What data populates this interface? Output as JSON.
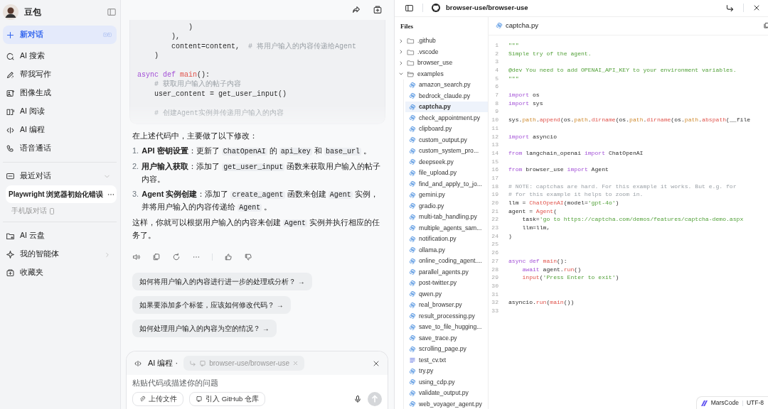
{
  "sidebar": {
    "brand": "豆包",
    "new_chat": {
      "label": "新对话",
      "selected": true
    },
    "nav_items": [
      {
        "label": "AI 搜索"
      },
      {
        "label": "帮我写作"
      },
      {
        "label": "图像生成"
      },
      {
        "label": "AI 阅读"
      },
      {
        "label": "AI 编程"
      },
      {
        "label": "语音通话"
      }
    ],
    "recent": {
      "title": "最近对话",
      "expanded": true,
      "chats": [
        {
          "title": "Playwright 浏览器初始化错误",
          "selected": true
        }
      ],
      "mobile_link": "手机版对话"
    },
    "bottom_items": [
      {
        "label": "AI 云盘",
        "has_submenu": false
      },
      {
        "label": "我的智能体",
        "has_submenu": true
      },
      {
        "label": "收藏夹",
        "has_submenu": false
      }
    ]
  },
  "chat": {
    "code_lines": [
      {
        "space_before": false,
        "tokens": [
          {
            "text": "            )",
            "kind": "plain"
          }
        ]
      },
      {
        "space_before": false,
        "tokens": [
          {
            "text": "        ),",
            "kind": "plain"
          }
        ]
      },
      {
        "space_before": false,
        "tokens": [
          {
            "text": "        content=content,  ",
            "kind": "plain"
          },
          {
            "text": "# 将用户输入的内容传递给Agent",
            "kind": "comment"
          }
        ]
      },
      {
        "space_before": false,
        "tokens": [
          {
            "text": "    )",
            "kind": "plain"
          }
        ]
      },
      {
        "space_before": true,
        "tokens": [
          {
            "text": "async def ",
            "kind": "keyword"
          },
          {
            "text": "main",
            "kind": "function"
          },
          {
            "text": "():",
            "kind": "plain"
          }
        ]
      },
      {
        "space_before": false,
        "tokens": [
          {
            "text": "    # 获取用户输入的帖子内容",
            "kind": "comment"
          }
        ]
      },
      {
        "space_before": false,
        "tokens": [
          {
            "text": "    user_content = get_user_input()",
            "kind": "plain"
          }
        ]
      },
      {
        "space_before": true,
        "tokens": [
          {
            "text": "    # 创建Agent实例并传递用户输入的内容",
            "kind": "comment"
          }
        ]
      }
    ],
    "intro": "在上述代码中，主要做了以下修改：",
    "list": [
      {
        "number": "1.",
        "parts": [
          {
            "text": "API 密钥设置",
            "kind": "bold"
          },
          {
            "text": "：更新了 ",
            "kind": "plain"
          },
          {
            "text": "ChatOpenAI",
            "kind": "code"
          },
          {
            "text": " 的 ",
            "kind": "plain"
          },
          {
            "text": "api_key",
            "kind": "code"
          },
          {
            "text": " 和 ",
            "kind": "plain"
          },
          {
            "text": "base_url",
            "kind": "code"
          },
          {
            "text": " 。",
            "kind": "plain"
          }
        ]
      },
      {
        "number": "2.",
        "parts": [
          {
            "text": "用户输入获取",
            "kind": "bold"
          },
          {
            "text": "：添加了 ",
            "kind": "plain"
          },
          {
            "text": "get_user_input",
            "kind": "code"
          },
          {
            "text": " 函数来获取用户输入的帖子内容。",
            "kind": "plain"
          }
        ]
      },
      {
        "number": "3.",
        "parts": [
          {
            "text": "Agent 实例创建",
            "kind": "bold"
          },
          {
            "text": "：添加了 ",
            "kind": "plain"
          },
          {
            "text": "create_agent",
            "kind": "code"
          },
          {
            "text": " 函数来创建 ",
            "kind": "plain"
          },
          {
            "text": "Agent",
            "kind": "code"
          },
          {
            "text": " 实例，并将用户输入的内容传递给 ",
            "kind": "plain"
          },
          {
            "text": "Agent",
            "kind": "code"
          },
          {
            "text": " 。",
            "kind": "plain"
          }
        ]
      }
    ],
    "outro": [
      {
        "text": "这样，你就可以根据用户输入的内容来创建 ",
        "kind": "plain"
      },
      {
        "text": "Agent",
        "kind": "code"
      },
      {
        "text": " 实例并执行相应的任务了。",
        "kind": "plain"
      }
    ],
    "suggestions": [
      "如何将用户输入的内容进行进一步的处理或分析？ →",
      "如果要添加多个标签，应该如何修改代码？ →",
      "如何处理用户输入的内容为空的情况？ →"
    ],
    "composer": {
      "mode": "AI 编程 ·",
      "repo": "browser-use/browser-use",
      "placeholder": "粘贴代码或描述你的问题",
      "buttons": [
        "上传文件",
        "引入 GitHub 仓库"
      ]
    }
  },
  "repo_panel": {
    "title": "browser-use/browser-use",
    "files_title": "Files",
    "tree": [
      {
        "name": ".github",
        "kind": "folder",
        "expanded": false
      },
      {
        "name": ".vscode",
        "kind": "folder",
        "expanded": false
      },
      {
        "name": "browser_use",
        "kind": "folder",
        "expanded": false
      },
      {
        "name": "examples",
        "kind": "folder",
        "expanded": true,
        "children": [
          {
            "name": "amazon_search.py",
            "kind": "python",
            "selected": false
          },
          {
            "name": "bedrock_claude.py",
            "kind": "python",
            "selected": false
          },
          {
            "name": "captcha.py",
            "kind": "python",
            "selected": true
          },
          {
            "name": "check_appointment.py",
            "kind": "python",
            "selected": false
          },
          {
            "name": "clipboard.py",
            "kind": "python",
            "selected": false
          },
          {
            "name": "custom_output.py",
            "kind": "python",
            "selected": false
          },
          {
            "name": "custom_system_pro...",
            "kind": "python",
            "selected": false
          },
          {
            "name": "deepseek.py",
            "kind": "python",
            "selected": false
          },
          {
            "name": "file_upload.py",
            "kind": "python",
            "selected": false
          },
          {
            "name": "find_and_apply_to_jo...",
            "kind": "python",
            "selected": false
          },
          {
            "name": "gemini.py",
            "kind": "python",
            "selected": false
          },
          {
            "name": "gradio.py",
            "kind": "python",
            "selected": false
          },
          {
            "name": "multi-tab_handling.py",
            "kind": "python",
            "selected": false
          },
          {
            "name": "multiple_agents_sam...",
            "kind": "python",
            "selected": false
          },
          {
            "name": "notification.py",
            "kind": "python",
            "selected": false
          },
          {
            "name": "ollama.py",
            "kind": "python",
            "selected": false
          },
          {
            "name": "online_coding_agent....",
            "kind": "python",
            "selected": false
          },
          {
            "name": "parallel_agents.py",
            "kind": "python",
            "selected": false
          },
          {
            "name": "post-twitter.py",
            "kind": "python",
            "selected": false
          },
          {
            "name": "qwen.py",
            "kind": "python",
            "selected": false
          },
          {
            "name": "real_browser.py",
            "kind": "python",
            "selected": false
          },
          {
            "name": "result_processing.py",
            "kind": "python",
            "selected": false
          },
          {
            "name": "save_to_file_hugging...",
            "kind": "python",
            "selected": false
          },
          {
            "name": "save_trace.py",
            "kind": "python",
            "selected": false
          },
          {
            "name": "scrolling_page.py",
            "kind": "python",
            "selected": false
          },
          {
            "name": "test_cv.txt",
            "kind": "text",
            "selected": false
          },
          {
            "name": "try.py",
            "kind": "python",
            "selected": false
          },
          {
            "name": "using_cdp.py",
            "kind": "python",
            "selected": false
          },
          {
            "name": "validate_output.py",
            "kind": "python",
            "selected": false
          },
          {
            "name": "web_voyager_agent.py",
            "kind": "python",
            "selected": false
          }
        ]
      }
    ],
    "editor": {
      "file_name": "captcha.py",
      "lines": [
        {
          "number": "1",
          "tokens": [
            {
              "text": "\"\"\"",
              "kind": "string"
            }
          ]
        },
        {
          "number": "2",
          "tokens": [
            {
              "text": "Simple try of the agent.",
              "kind": "string"
            }
          ]
        },
        {
          "number": "3"
        },
        {
          "number": "4",
          "tokens": [
            {
              "text": "@dev You need to add OPENAI_API_KEY to your environment variables.",
              "kind": "string"
            }
          ]
        },
        {
          "number": "5",
          "tokens": [
            {
              "text": "\"\"\"",
              "kind": "string"
            }
          ]
        },
        {
          "number": "6"
        },
        {
          "number": "7",
          "tokens": [
            {
              "text": "import",
              "kind": "keyword"
            },
            {
              "text": " os",
              "kind": "plain"
            }
          ]
        },
        {
          "number": "8",
          "tokens": [
            {
              "text": "import",
              "kind": "keyword"
            },
            {
              "text": " sys",
              "kind": "plain"
            }
          ]
        },
        {
          "number": "9"
        },
        {
          "number": "10",
          "tokens": [
            {
              "text": "sys.",
              "kind": "plain"
            },
            {
              "text": "path",
              "kind": "attribute"
            },
            {
              "text": ".",
              "kind": "plain"
            },
            {
              "text": "append",
              "kind": "function"
            },
            {
              "text": "(os.",
              "kind": "plain"
            },
            {
              "text": "path",
              "kind": "attribute"
            },
            {
              "text": ".",
              "kind": "plain"
            },
            {
              "text": "dirname",
              "kind": "function"
            },
            {
              "text": "(os.",
              "kind": "plain"
            },
            {
              "text": "path",
              "kind": "attribute"
            },
            {
              "text": ".",
              "kind": "plain"
            },
            {
              "text": "dirname",
              "kind": "function"
            },
            {
              "text": "(os.",
              "kind": "plain"
            },
            {
              "text": "path",
              "kind": "attribute"
            },
            {
              "text": ".",
              "kind": "plain"
            },
            {
              "text": "abspath",
              "kind": "function"
            },
            {
              "text": "(__file",
              "kind": "plain"
            }
          ]
        },
        {
          "number": "11"
        },
        {
          "number": "12",
          "tokens": [
            {
              "text": "import",
              "kind": "keyword"
            },
            {
              "text": " asyncio",
              "kind": "plain"
            }
          ]
        },
        {
          "number": "13"
        },
        {
          "number": "14",
          "tokens": [
            {
              "text": "from",
              "kind": "keyword"
            },
            {
              "text": " langchain_openai ",
              "kind": "plain"
            },
            {
              "text": "import",
              "kind": "keyword"
            },
            {
              "text": " ChatOpenAI",
              "kind": "plain"
            }
          ]
        },
        {
          "number": "15"
        },
        {
          "number": "16",
          "tokens": [
            {
              "text": "from",
              "kind": "keyword"
            },
            {
              "text": " browser_use ",
              "kind": "plain"
            },
            {
              "text": "import",
              "kind": "keyword"
            },
            {
              "text": " Agent",
              "kind": "plain"
            }
          ]
        },
        {
          "number": "17"
        },
        {
          "number": "18",
          "tokens": [
            {
              "text": "# NOTE: captchas are hard. For this example it works. But e.g. for",
              "kind": "comment"
            }
          ]
        },
        {
          "number": "19",
          "tokens": [
            {
              "text": "# for this example it helps to zoom in.",
              "kind": "comment"
            }
          ]
        },
        {
          "number": "20",
          "tokens": [
            {
              "text": "llm = ",
              "kind": "plain"
            },
            {
              "text": "ChatOpenAI",
              "kind": "function"
            },
            {
              "text": "(model=",
              "kind": "plain"
            },
            {
              "text": "'gpt-4o'",
              "kind": "string"
            },
            {
              "text": ")",
              "kind": "plain"
            }
          ]
        },
        {
          "number": "21",
          "tokens": [
            {
              "text": "agent = ",
              "kind": "plain"
            },
            {
              "text": "Agent",
              "kind": "function"
            },
            {
              "text": "(",
              "kind": "plain"
            }
          ]
        },
        {
          "number": "22",
          "tokens": [
            {
              "text": "    task=",
              "kind": "plain"
            },
            {
              "text": "'go to https://captcha.com/demos/features/captcha-demo.aspx",
              "kind": "string"
            }
          ]
        },
        {
          "number": "23",
          "tokens": [
            {
              "text": "    llm=llm,",
              "kind": "plain"
            }
          ]
        },
        {
          "number": "24",
          "tokens": [
            {
              "text": ")",
              "kind": "plain"
            }
          ]
        },
        {
          "number": "25"
        },
        {
          "number": "26"
        },
        {
          "number": "27",
          "tokens": [
            {
              "text": "async def ",
              "kind": "keyword"
            },
            {
              "text": "main",
              "kind": "function"
            },
            {
              "text": "():",
              "kind": "plain"
            }
          ]
        },
        {
          "number": "28",
          "tokens": [
            {
              "text": "    await",
              "kind": "keyword"
            },
            {
              "text": " agent.",
              "kind": "plain"
            },
            {
              "text": "run",
              "kind": "function"
            },
            {
              "text": "()",
              "kind": "plain"
            }
          ]
        },
        {
          "number": "29",
          "tokens": [
            {
              "text": "    input",
              "kind": "function"
            },
            {
              "text": "(",
              "kind": "plain"
            },
            {
              "text": "'Press Enter to exit'",
              "kind": "string"
            },
            {
              "text": ")",
              "kind": "plain"
            }
          ]
        },
        {
          "number": "30"
        },
        {
          "number": "31"
        },
        {
          "number": "32",
          "tokens": [
            {
              "text": "asyncio.",
              "kind": "plain"
            },
            {
              "text": "run",
              "kind": "function"
            },
            {
              "text": "(",
              "kind": "plain"
            },
            {
              "text": "main",
              "kind": "function"
            },
            {
              "text": "())",
              "kind": "plain"
            }
          ]
        },
        {
          "number": "33"
        }
      ]
    },
    "status_bar": {
      "brand": "MarsCode",
      "encoding": "UTF-8"
    }
  }
}
